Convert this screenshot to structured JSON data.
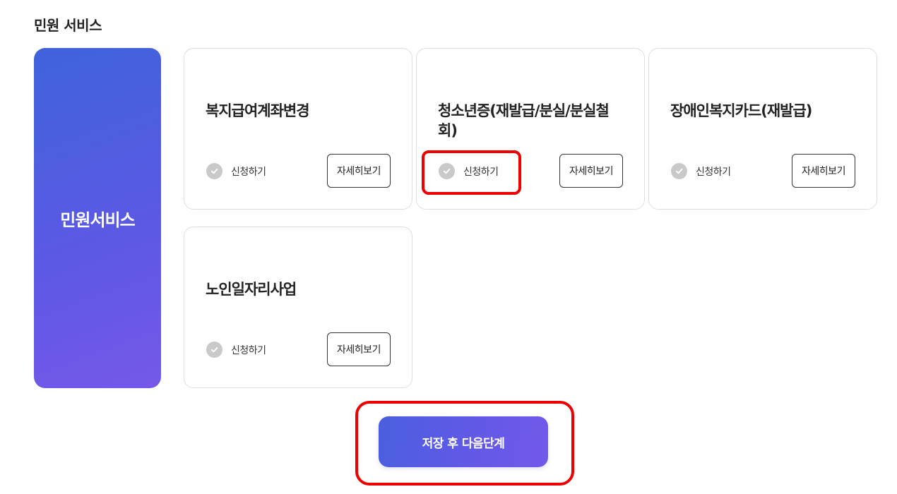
{
  "section": {
    "title": "민원 서비스"
  },
  "side_panel": {
    "label": "민원서비스"
  },
  "cards": [
    {
      "title": "복지급여계좌변경",
      "apply_label": "신청하기",
      "detail_label": "자세히보기"
    },
    {
      "title": "청소년증(재발급/분실/분실철회)",
      "apply_label": "신청하기",
      "detail_label": "자세히보기"
    },
    {
      "title": "장애인복지카드(재발급)",
      "apply_label": "신청하기",
      "detail_label": "자세히보기"
    },
    {
      "title": "노인일자리사업",
      "apply_label": "신청하기",
      "detail_label": "자세히보기"
    }
  ],
  "next_button": {
    "label": "저장 후 다음단계"
  },
  "colors": {
    "accent_start": "#3f63dc",
    "accent_end": "#7658ea",
    "highlight": "#ee0000",
    "check_inactive": "#c9c9c9"
  },
  "icons": {
    "check": "check-circle-icon"
  }
}
